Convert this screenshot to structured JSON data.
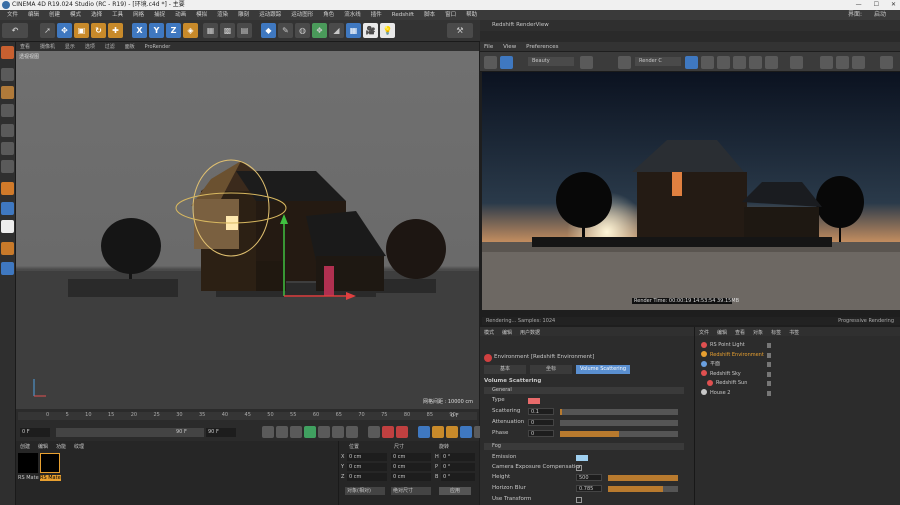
{
  "titlebar": {
    "title": "CINEMA 4D R19.024 Studio (RC - R19) - [环境.c4d *] - 主要"
  },
  "menu": [
    "文件",
    "编辑",
    "创建",
    "模式",
    "选择",
    "工具",
    "网格",
    "捕捉",
    "动画",
    "模拟",
    "渲染",
    "雕刻",
    "运动跟踪",
    "运动图形",
    "角色",
    "流水线",
    "插件",
    "Redshift",
    "脚本",
    "窗口",
    "帮助"
  ],
  "menu_right": [
    "界面:",
    "启动"
  ],
  "viewport": {
    "menu": [
      "查看",
      "摄像机",
      "显示",
      "选项",
      "过滤",
      "面板",
      "ProRender"
    ],
    "label": "透视视图",
    "grid_info": "网格间距 : 10000 cm"
  },
  "timeline": {
    "ticks": [
      "0",
      "5",
      "10",
      "15",
      "20",
      "25",
      "30",
      "35",
      "40",
      "45",
      "50",
      "55",
      "60",
      "65",
      "70",
      "75",
      "80",
      "85",
      "90"
    ],
    "frame_end": "0 F",
    "start": "0 F",
    "current": "90 F",
    "end": "90 F"
  },
  "materials": {
    "menu": [
      "创建",
      "编辑",
      "功能",
      "纹理"
    ],
    "items": [
      {
        "name": "RS Mate"
      },
      {
        "name": "RS Mate"
      }
    ]
  },
  "coords": {
    "headers": [
      "位置",
      "尺寸",
      "旋转"
    ],
    "rows": [
      {
        "axis": "X",
        "pos": "0 cm",
        "size": "0 cm",
        "rot_label": "H",
        "rot": "0 °"
      },
      {
        "axis": "Y",
        "pos": "0 cm",
        "size": "0 cm",
        "rot_label": "P",
        "rot": "0 °"
      },
      {
        "axis": "Z",
        "pos": "0 cm",
        "size": "0 cm",
        "rot_label": "B",
        "rot": "0 °"
      }
    ],
    "mode": "对象(相对)",
    "size_mode": "绝对尺寸",
    "apply": "应用"
  },
  "redshift": {
    "title": "Redshift RenderView",
    "menu": [
      "File",
      "View",
      "Preferences"
    ],
    "beauty": "Beauty",
    "render_cam": "Render C",
    "overlay": "Render Time: 00:00:19   14:53:54   39.15MB",
    "status_left": "Rendering... Samples: 1024",
    "status_right": "Progressive Rendering"
  },
  "attr": {
    "tabs": [
      "模式",
      "编辑",
      "用户数据"
    ],
    "object": "Environment [Redshift Environment]",
    "subtabs": [
      "基本",
      "坐标",
      "Volume Scattering"
    ],
    "section": "Volume Scattering",
    "group_general": "General",
    "type_label": "Type",
    "scattering_label": "Scattering",
    "scattering_val": "0.1",
    "attenuation_label": "Attenuation",
    "attenuation_val": "0",
    "phase_label": "Phase",
    "phase_val": "0",
    "group_fog": "Fog",
    "emission_label": "Emission",
    "camera_exp_label": "Camera Exposure Compensation",
    "height_label": "Height",
    "height_val": "500",
    "horizon_label": "Horizon Blur",
    "horizon_val": "0.785",
    "use_transform_label": "Use Transform",
    "colors": {
      "type_swatch": "#e96b6b",
      "emission_swatch": "#9fcff0"
    }
  },
  "objects": {
    "menu": [
      "文件",
      "编辑",
      "查看",
      "对象",
      "标签",
      "书签"
    ],
    "items": [
      {
        "name": "RS Point Light",
        "color": "#e05050"
      },
      {
        "name": "Redshift Environment",
        "color": "#e8a030"
      },
      {
        "name": "平面",
        "color": "#6aa0e0"
      },
      {
        "name": "Redshift Sky",
        "color": "#e05050"
      },
      {
        "name": "Redshift Sun",
        "color": "#e05050"
      },
      {
        "name": "House 2",
        "color": "#c8c8c8"
      }
    ]
  }
}
